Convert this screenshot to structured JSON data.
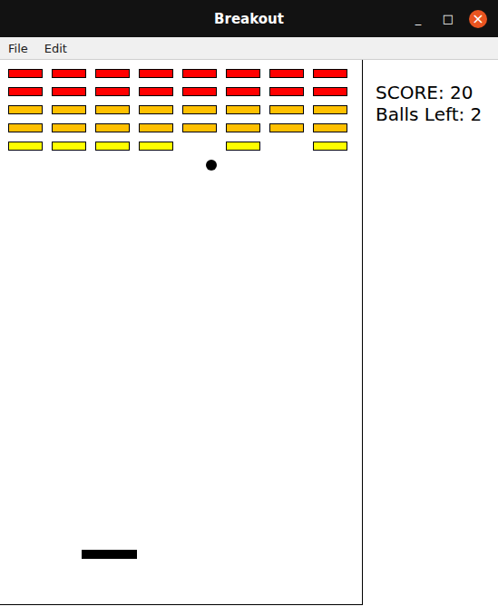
{
  "window": {
    "title": "Breakout",
    "controls": [
      {
        "name": "minimize",
        "glyph": "_"
      },
      {
        "name": "maximize",
        "glyph": "□"
      },
      {
        "name": "close",
        "glyph": "×"
      }
    ]
  },
  "menu": [
    {
      "label": "File"
    },
    {
      "label": "Edit"
    }
  ],
  "bricks": [
    {
      "color": "#ff0000",
      "present": [
        true,
        true,
        true,
        true,
        true,
        true,
        true,
        true
      ]
    },
    {
      "color": "#ff0000",
      "present": [
        true,
        true,
        true,
        true,
        true,
        true,
        true,
        true
      ]
    },
    {
      "color": "#ffc000",
      "present": [
        true,
        true,
        true,
        true,
        true,
        true,
        true,
        true
      ]
    },
    {
      "color": "#ffc000",
      "present": [
        true,
        true,
        true,
        true,
        true,
        true,
        true,
        true
      ]
    },
    {
      "color": "#ffff00",
      "present": [
        true,
        true,
        true,
        true,
        false,
        true,
        false,
        true
      ]
    }
  ],
  "status": {
    "score": "SCORE: 20",
    "balls": "Balls Left: 2"
  }
}
